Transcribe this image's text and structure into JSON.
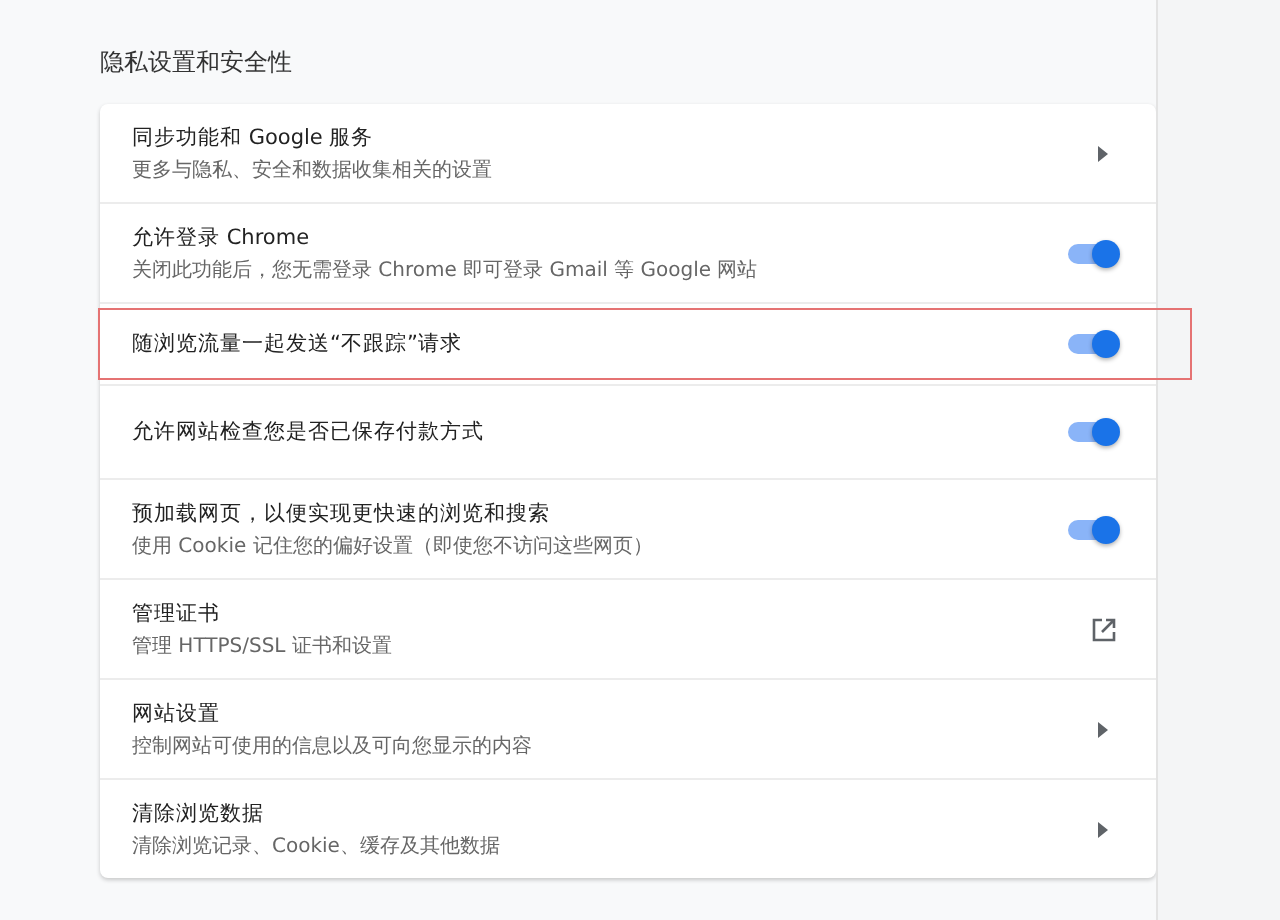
{
  "section_title": "隐私设置和安全性",
  "rows": [
    {
      "title": "同步功能和 Google 服务",
      "subtitle": "更多与隐私、安全和数据收集相关的设置",
      "kind": "arrow",
      "highlighted": false
    },
    {
      "title": "允许登录 Chrome",
      "subtitle": "关闭此功能后，您无需登录 Chrome 即可登录 Gmail 等 Google 网站",
      "kind": "toggle",
      "on": true,
      "highlighted": false
    },
    {
      "title": "随浏览流量一起发送“不跟踪”请求",
      "kind": "toggle",
      "on": true,
      "highlighted": true
    },
    {
      "title": "允许网站检查您是否已保存付款方式",
      "kind": "toggle",
      "on": true,
      "highlighted": false
    },
    {
      "title": "预加载网页，以便实现更快速的浏览和搜索",
      "subtitle": "使用 Cookie 记住您的偏好设置（即使您不访问这些网页）",
      "kind": "toggle",
      "on": true,
      "highlighted": false
    },
    {
      "title": "管理证书",
      "subtitle": "管理 HTTPS/SSL 证书和设置",
      "kind": "external",
      "highlighted": false
    },
    {
      "title": "网站设置",
      "subtitle": "控制网站可使用的信息以及可向您显示的内容",
      "kind": "arrow",
      "highlighted": false
    },
    {
      "title": "清除浏览数据",
      "subtitle": "清除浏览记录、Cookie、缓存及其他数据",
      "kind": "arrow",
      "highlighted": false
    }
  ]
}
